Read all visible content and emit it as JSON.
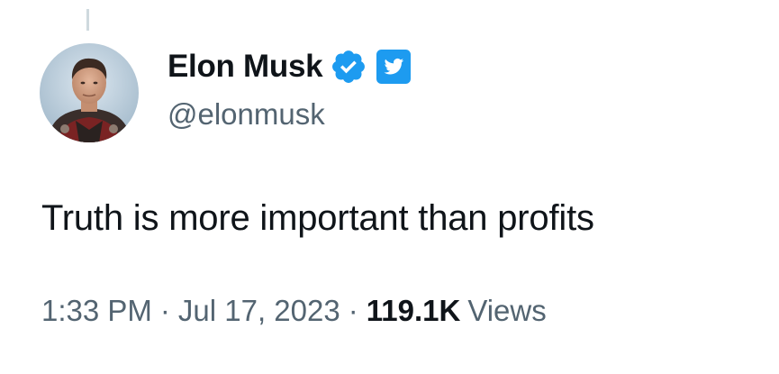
{
  "author": {
    "display_name": "Elon Musk",
    "handle": "@elonmusk",
    "verified_badge_icon": "verified-checkmark-icon",
    "affiliate_badge_icon": "twitter-bird-icon",
    "badge_color": "#1d9bf0"
  },
  "tweet": {
    "text": "Truth is more important than profits"
  },
  "meta": {
    "time": "1:33 PM",
    "separator": "·",
    "date": "Jul 17, 2023",
    "views_count": "119.1K",
    "views_label": "Views"
  },
  "colors": {
    "primary_text": "#0f1419",
    "secondary_text": "#536471",
    "accent": "#1d9bf0"
  }
}
